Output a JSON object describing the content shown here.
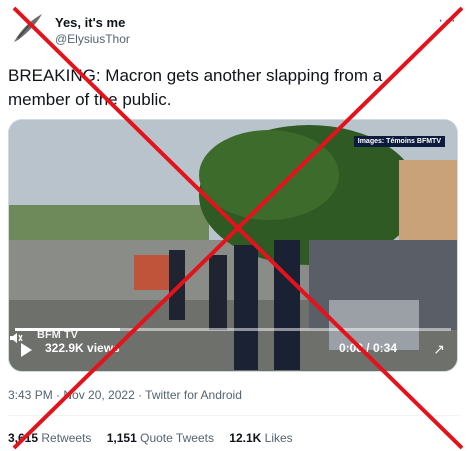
{
  "tweet": {
    "display_name": "Yes, it's me",
    "handle": "@ElysiusThor",
    "more_icon": "more-icon",
    "text": "BREAKING: Macron gets another slapping from a member of the public.",
    "media": {
      "credit": "Images: Témoins BFMTV",
      "watermark": "BFM TV",
      "views": "322.9K views",
      "time": "0:08 / 0:34",
      "progress": 0.24,
      "icons": [
        "play-icon",
        "volume-icon",
        "fullscreen-icon"
      ]
    },
    "timestamp": "3:43 PM · Nov 20, 2022 · Twitter for Android",
    "stats": [
      {
        "count": "3,615",
        "label": "Retweets"
      },
      {
        "count": "1,151",
        "label": "Quote Tweets"
      },
      {
        "count": "12.1K",
        "label": "Likes"
      }
    ]
  },
  "overlay": {
    "type": "fact-check-cross",
    "color": "#e3121b"
  }
}
